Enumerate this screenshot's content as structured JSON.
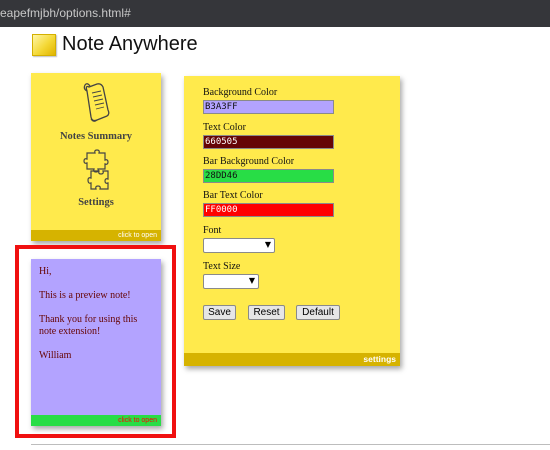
{
  "browser": {
    "url_fragment": "eapefmjbh/options.html#"
  },
  "app": {
    "title": "Note Anywhere"
  },
  "nav": {
    "summary_label": "Notes Summary",
    "settings_label": "Settings",
    "footer": "click to open"
  },
  "preview": {
    "lines": [
      "Hi,",
      "This is a preview note!",
      "Thank you for using this note extension!",
      "William"
    ],
    "footer": "click to open"
  },
  "settings": {
    "background_color": {
      "label": "Background Color",
      "value": "B3A3FF",
      "color": "#b3a3ff"
    },
    "text_color": {
      "label": "Text Color",
      "value": "660505",
      "color": "#660505"
    },
    "bar_background_color": {
      "label": "Bar Background Color",
      "value": "28DD46",
      "color": "#28dd46"
    },
    "bar_text_color": {
      "label": "Bar Text Color",
      "value": "FF0000",
      "color": "#ff0000"
    },
    "font": {
      "label": "Font",
      "value": ""
    },
    "text_size": {
      "label": "Text Size",
      "value": ""
    },
    "buttons": {
      "save": "Save",
      "reset": "Reset",
      "default": "Default"
    },
    "footer": "settings"
  },
  "colors": {
    "note_yellow": "#ffea4c",
    "bar_gold": "#d6b300",
    "highlight_red": "#f01010"
  }
}
